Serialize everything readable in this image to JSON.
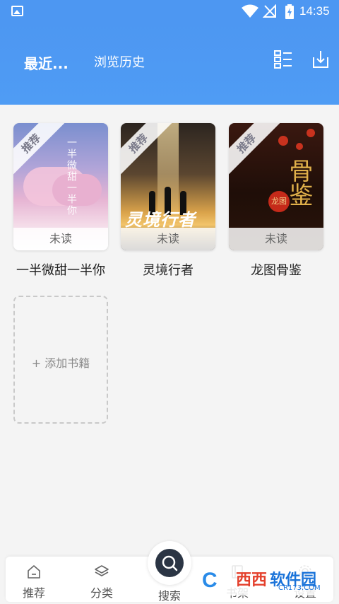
{
  "status_bar": {
    "time": "14:35"
  },
  "header": {
    "tab_recent": "最近...",
    "tab_history": "浏览历史"
  },
  "books": [
    {
      "title": "一半微甜一半你",
      "badge": "推荐",
      "status": "未读",
      "cover_text": "一半微甜一半你"
    },
    {
      "title": "灵境行者",
      "badge": "推荐",
      "status": "未读",
      "cover_text": "灵境行者"
    },
    {
      "title": "龙图骨鉴",
      "badge": "推荐",
      "status": "未读",
      "cover_text": "骨鉴",
      "cover_badge": "龙图"
    }
  ],
  "add_book_label": "+ 添加书籍",
  "bottom_nav": {
    "items": [
      {
        "label": "推荐",
        "icon": "home-icon"
      },
      {
        "label": "分类",
        "icon": "layers-icon"
      },
      {
        "label": "搜索",
        "icon": "search-icon"
      },
      {
        "label": "书架",
        "icon": "bookshelf-icon"
      },
      {
        "label": "设置",
        "icon": "gear-icon"
      }
    ]
  },
  "watermark": {
    "brand": "西西",
    "brand2": "软件园",
    "domain": "CR173.COM"
  },
  "colors": {
    "header": "#4d97f2",
    "background": "#f4f4f4",
    "fab": "#2b3544"
  }
}
